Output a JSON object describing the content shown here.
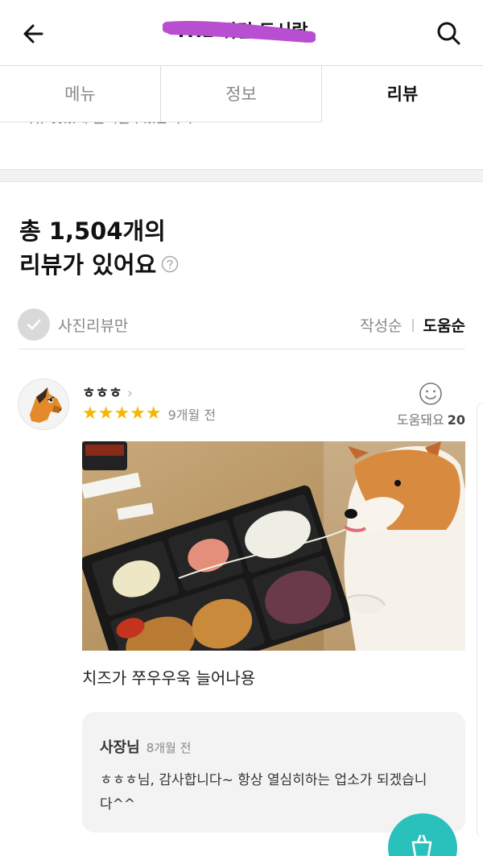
{
  "header": {
    "store_name": "THE 튀김 도시락",
    "back_icon": "arrow-left-icon",
    "search_icon": "search-icon"
  },
  "tabs": [
    {
      "label": "메뉴",
      "active": false
    },
    {
      "label": "정보",
      "active": false
    },
    {
      "label": "리뷰",
      "active": true
    }
  ],
  "cutoff_text": "리뷰 맛있게 즐겨줄수있습니다.",
  "summary": {
    "line1": "총 1,504개의",
    "line2": "리뷰가 있어요"
  },
  "filter": {
    "photo_only_label": "사진리뷰만",
    "sort_latest": "작성순",
    "sort_helpful": "도움순",
    "active_sort": "도움순"
  },
  "review": {
    "reviewer": "ㅎㅎㅎ",
    "rating": 5,
    "stars": "★★★★★",
    "date": "9개월 전",
    "helpful_label": "도움돼요",
    "helpful_count": "20",
    "text": "치즈가 쭈우우욱 늘어나용",
    "owner_reply": {
      "name": "사장님",
      "date": "8개월 전",
      "text": "ㅎㅎㅎ님, 감사합니다~ 항상 열심히하는 업소가 되겠습니다^^"
    }
  },
  "colors": {
    "accent": "#2ac1bc",
    "star": "#f5b800",
    "redaction": "#b84fd1"
  }
}
